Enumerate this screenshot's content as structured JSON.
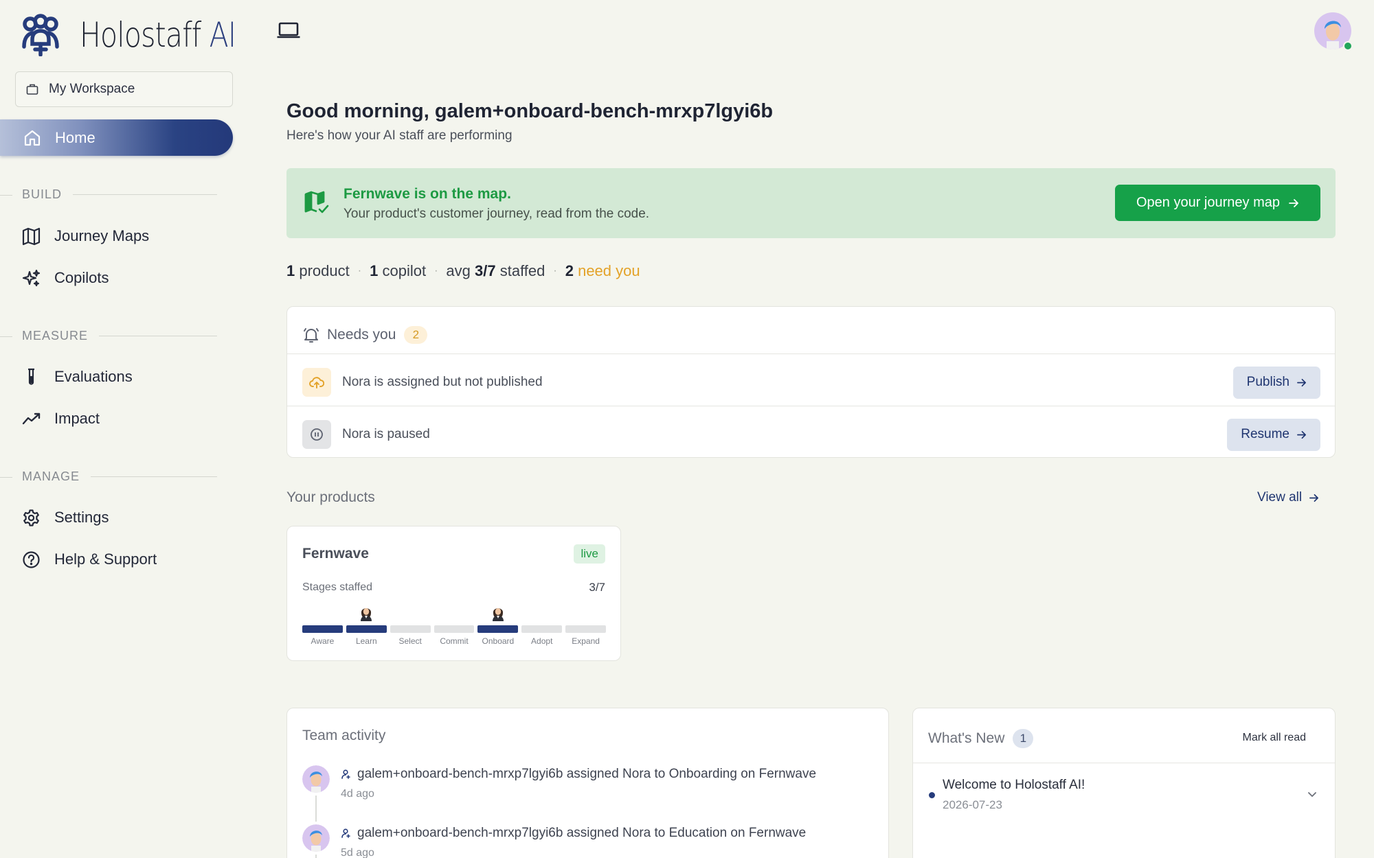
{
  "app": {
    "brand_main": "Holostaff",
    "brand_accent": "AI"
  },
  "sidebar": {
    "workspace_label": "My Workspace",
    "home_label": "Home",
    "sections": {
      "build": "BUILD",
      "measure": "MEASURE",
      "manage": "MANAGE"
    },
    "items": {
      "journey_maps": "Journey Maps",
      "copilots": "Copilots",
      "evaluations": "Evaluations",
      "impact": "Impact",
      "settings": "Settings",
      "help": "Help & Support"
    }
  },
  "header": {
    "greeting": "Good morning, galem+onboard-bench-mrxp7lgyi6b",
    "subtitle": "Here's how your AI staff are performing"
  },
  "banner": {
    "title": "Fernwave is on the map.",
    "subtitle": "Your product's customer journey, read from the code.",
    "button": "Open your journey map"
  },
  "stats": {
    "products_count": "1",
    "products_label": "product",
    "copilots_count": "1",
    "copilots_label": "copilot",
    "avg_label": "avg",
    "staffed_value": "3/7",
    "staffed_label": "staffed",
    "need_count": "2",
    "need_label": "need you"
  },
  "needs_you": {
    "title": "Needs you",
    "count": "2",
    "items": [
      {
        "text": "Nora is assigned but not published",
        "action": "Publish",
        "icon": "cloud-upload-icon"
      },
      {
        "text": "Nora is paused",
        "action": "Resume",
        "icon": "pause-icon"
      }
    ]
  },
  "products": {
    "title": "Your products",
    "view_all": "View all",
    "cards": [
      {
        "name": "Fernwave",
        "status": "live",
        "staffed_label": "Stages staffed",
        "staffed_value": "3/7",
        "stages": [
          {
            "label": "Aware",
            "staffed": true,
            "person": false
          },
          {
            "label": "Learn",
            "staffed": true,
            "person": true
          },
          {
            "label": "Select",
            "staffed": false,
            "person": false
          },
          {
            "label": "Commit",
            "staffed": false,
            "person": false
          },
          {
            "label": "Onboard",
            "staffed": true,
            "person": true
          },
          {
            "label": "Adopt",
            "staffed": false,
            "person": false
          },
          {
            "label": "Expand",
            "staffed": false,
            "person": false
          }
        ]
      }
    ]
  },
  "activity": {
    "title": "Team activity",
    "items": [
      {
        "text": "galem+onboard-bench-mrxp7lgyi6b assigned Nora to Onboarding on Fernwave",
        "time": "4d ago"
      },
      {
        "text": "galem+onboard-bench-mrxp7lgyi6b assigned Nora to Education on Fernwave",
        "time": "5d ago"
      }
    ]
  },
  "whats_new": {
    "title": "What's New",
    "count": "1",
    "mark_all": "Mark all read",
    "items": [
      {
        "title": "Welcome to Holostaff AI!",
        "date": "2026-07-23"
      }
    ]
  },
  "colors": {
    "accent_navy": "#263c7c",
    "success_green": "#16a149",
    "warning_amber": "#e3a228",
    "background": "#f4f5ee"
  }
}
